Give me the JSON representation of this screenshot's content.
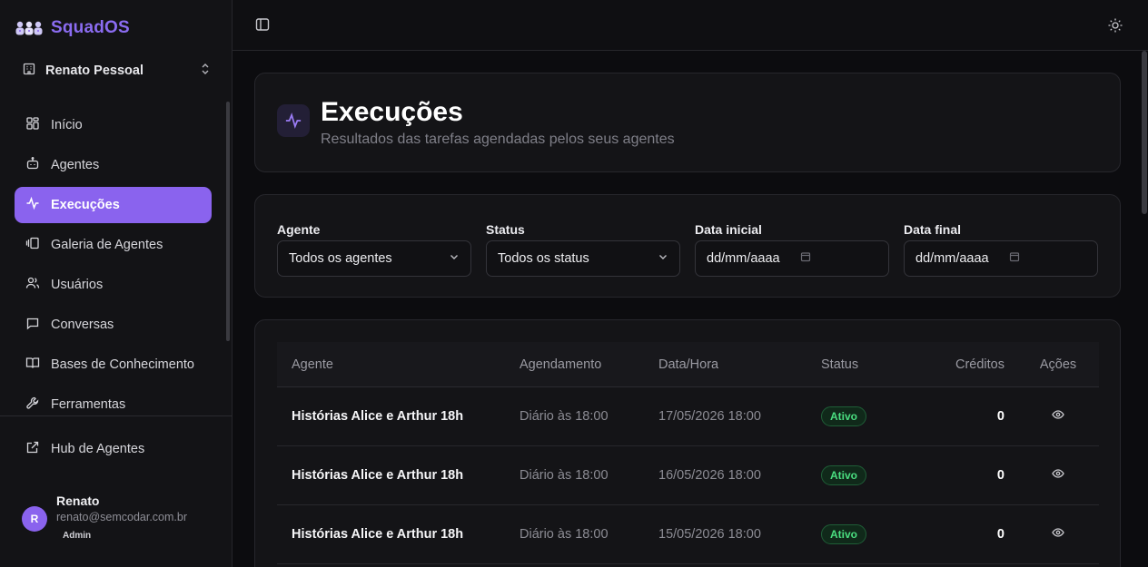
{
  "app": {
    "name": "SquadOS",
    "logo_icon": "squad-logo-icon",
    "accent": "#8a63ee"
  },
  "workspace": {
    "name": "Renato Pessoal",
    "icon": "building-icon"
  },
  "sidebar": {
    "items": [
      {
        "label": "Início",
        "icon": "dashboard-icon",
        "active": false
      },
      {
        "label": "Agentes",
        "icon": "bot-icon",
        "active": false
      },
      {
        "label": "Execuções",
        "icon": "activity-icon",
        "active": true
      },
      {
        "label": "Galeria de Agentes",
        "icon": "gallery-icon",
        "active": false
      },
      {
        "label": "Usuários",
        "icon": "users-icon",
        "active": false
      },
      {
        "label": "Conversas",
        "icon": "chat-icon",
        "active": false
      },
      {
        "label": "Bases de Conhecimento",
        "icon": "book-icon",
        "active": false
      },
      {
        "label": "Ferramentas",
        "icon": "wrench-icon",
        "active": false
      }
    ],
    "hub": {
      "label": "Hub de Agentes",
      "icon": "external-link-icon"
    }
  },
  "user": {
    "initial": "R",
    "name": "Renato",
    "email": "renato@semcodar.com.br",
    "role": "Admin"
  },
  "page": {
    "title": "Execuções",
    "subtitle": "Resultados das tarefas agendadas pelos seus agentes"
  },
  "filters": {
    "agent": {
      "label": "Agente",
      "value": "Todos os agentes"
    },
    "status": {
      "label": "Status",
      "value": "Todos os status"
    },
    "start_date": {
      "label": "Data inicial",
      "value": "dd/mm/aaaa"
    },
    "end_date": {
      "label": "Data final",
      "value": "dd/mm/aaaa"
    }
  },
  "table": {
    "columns": [
      "Agente",
      "Agendamento",
      "Data/Hora",
      "Status",
      "Créditos",
      "Ações"
    ],
    "rows": [
      {
        "agent": "Histórias Alice e Arthur 18h",
        "schedule": "Diário às 18:00",
        "datetime": "17/05/2026 18:00",
        "status": "Ativo",
        "credits": "0"
      },
      {
        "agent": "Histórias Alice e Arthur 18h",
        "schedule": "Diário às 18:00",
        "datetime": "16/05/2026 18:00",
        "status": "Ativo",
        "credits": "0"
      },
      {
        "agent": "Histórias Alice e Arthur 18h",
        "schedule": "Diário às 18:00",
        "datetime": "15/05/2026 18:00",
        "status": "Ativo",
        "credits": "0"
      }
    ]
  }
}
